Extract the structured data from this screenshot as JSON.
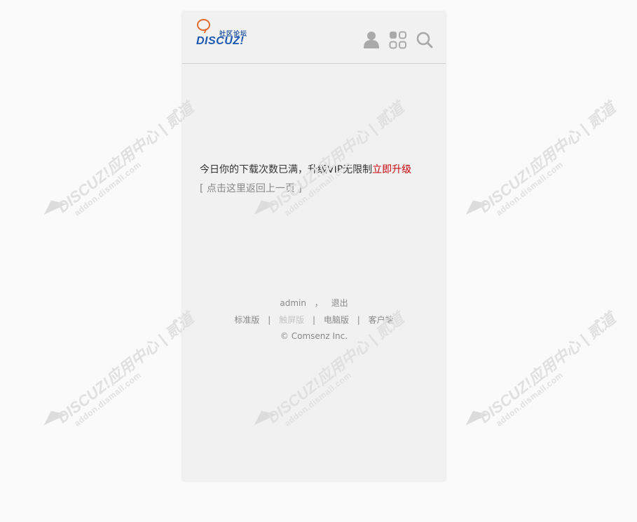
{
  "header": {
    "logo_tag": "社区论坛",
    "logo_brand": "DISCUZ!"
  },
  "message": {
    "text": "今日你的下载次数已满，升级VIP无限制",
    "upgrade_link": "立即升级",
    "back_link": "[ 点击这里返回上一页 ]"
  },
  "footer": {
    "user": "admin",
    "user_sep": "，",
    "logout": "退出",
    "version_links": [
      "标准版",
      "触屏版",
      "电脑版",
      "客户端"
    ],
    "link_sep": "|",
    "copyright": "© Comsenz Inc."
  },
  "watermark": {
    "text": "DISCUZ!应用中心 | 贰道",
    "sub": "addon.dismall.com"
  },
  "colors": {
    "accent_red": "#c8000a",
    "brand_blue": "#1d58b0",
    "logo_orange": "#e06a2c"
  }
}
